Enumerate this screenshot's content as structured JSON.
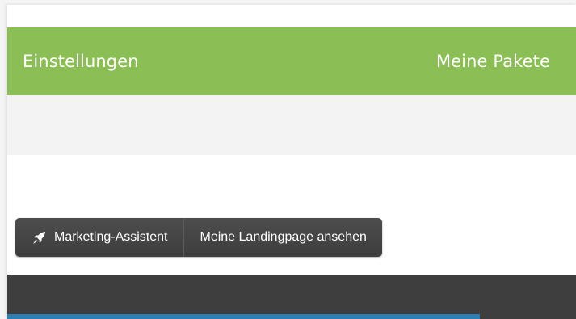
{
  "nav": {
    "left_label": "Einstellungen",
    "right_label": "Meine Pakete"
  },
  "toolbar": {
    "marketing_icon": "rocket-icon",
    "marketing_label": "Marketing-Assistent",
    "landing_label": "Meine Landingpage ansehen"
  },
  "colors": {
    "nav_green": "#8bbf55",
    "button_dark": "#464646",
    "footer_dark": "#3e3e3e",
    "footer_blue": "#2b7fb4"
  }
}
